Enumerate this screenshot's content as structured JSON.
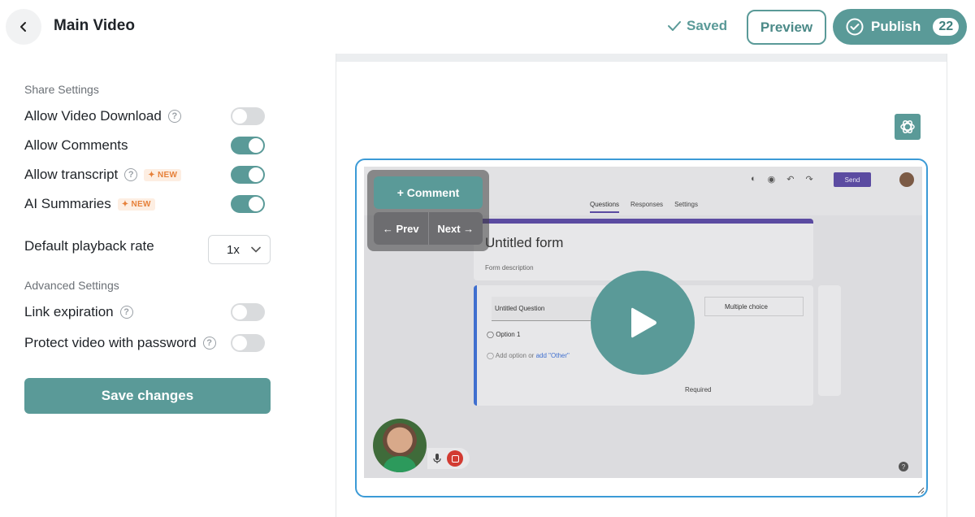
{
  "header": {
    "title": "Main Video",
    "saved_label": "Saved",
    "preview_label": "Preview",
    "publish_label": "Publish",
    "publish_count": "22"
  },
  "sidebar": {
    "share_settings_label": "Share Settings",
    "advanced_settings_label": "Advanced Settings",
    "new_badge": "✦ NEW",
    "help_glyph": "?",
    "settings": [
      {
        "label": "Allow Video Download",
        "enabled": false
      },
      {
        "label": "Allow Comments",
        "enabled": true
      },
      {
        "label": "Allow transcript",
        "enabled": true
      },
      {
        "label": "AI Summaries",
        "enabled": true
      }
    ],
    "playback_rate": {
      "label": "Default playback rate",
      "value": "1x"
    },
    "advanced": [
      {
        "label": "Link expiration",
        "enabled": false
      },
      {
        "label": "Protect video with password",
        "enabled": false
      }
    ],
    "save_label": "Save changes"
  },
  "player": {
    "comment_label": "+ Comment",
    "prev_label": "← Prev",
    "next_label": "Next →"
  },
  "video_content": {
    "send_label": "Send",
    "tabs": [
      "Questions",
      "Responses",
      "Settings"
    ],
    "form_title": "Untitled form",
    "form_description": "Form description",
    "question": "Untitled Question",
    "question_type": "Multiple choice",
    "option1": "Option 1",
    "add_option": "Add option",
    "or_text": "or",
    "add_other": "add \"Other\"",
    "required_label": "Required",
    "help_glyph": "?"
  },
  "colors": {
    "accent": "#5a9a98",
    "focus_border": "#3b9ad6",
    "new_badge": "#e6813a"
  }
}
